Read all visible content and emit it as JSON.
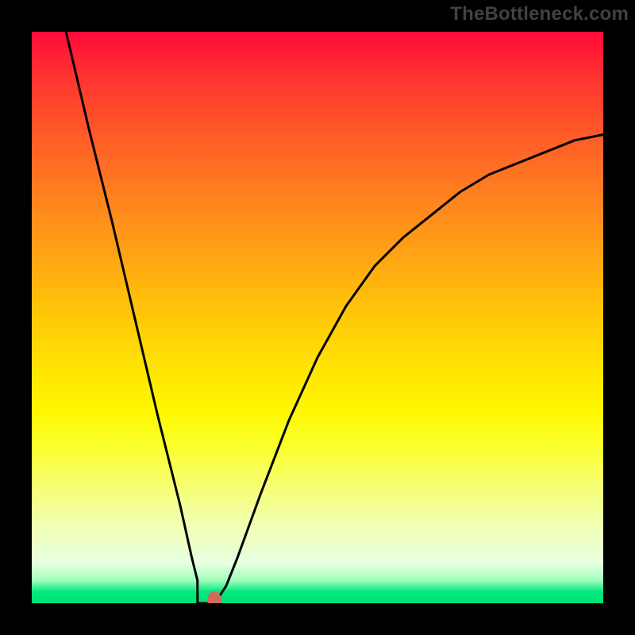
{
  "attribution": "TheBottleneck.com",
  "colors": {
    "frame": "#000000",
    "attribution_text": "#414141",
    "curve": "#000000",
    "marker": "#cf6a5d",
    "gradient_top": "#ff0a3a",
    "gradient_bottom": "#00e173"
  },
  "chart_data": {
    "type": "line",
    "title": "",
    "xlabel": "",
    "ylabel": "",
    "xlim": [
      0,
      100
    ],
    "ylim": [
      0,
      100
    ],
    "grid": false,
    "series": [
      {
        "name": "bottleneck-curve",
        "x": [
          6,
          10,
          14,
          18,
          22,
          26,
          28,
          29,
          30,
          31,
          32,
          34,
          36,
          40,
          45,
          50,
          55,
          60,
          65,
          70,
          75,
          80,
          85,
          90,
          95,
          100
        ],
        "y": [
          100,
          83,
          67,
          50,
          33,
          17,
          8,
          4,
          0,
          0,
          0,
          3,
          8,
          19,
          32,
          43,
          52,
          59,
          64,
          68,
          72,
          75,
          77,
          79,
          81,
          82
        ]
      }
    ],
    "flat_segment": {
      "x_start": 29,
      "x_end": 32,
      "y": 0
    },
    "marker": {
      "x": 32,
      "y": 0.5
    },
    "background": "vertical-rainbow-gradient (red top → green bottom)"
  }
}
